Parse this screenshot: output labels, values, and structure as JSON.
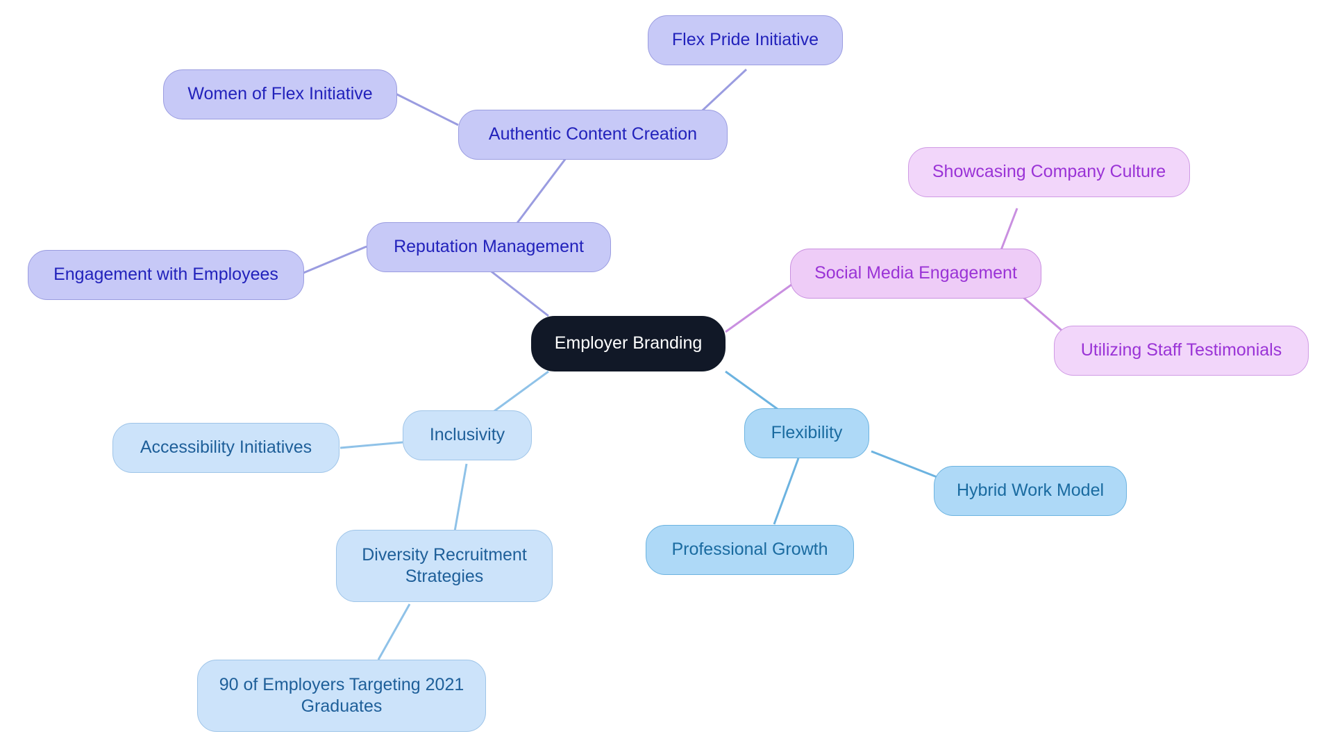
{
  "diagram": {
    "type": "mindmap",
    "title": "Employer Branding",
    "background_color": "#ffffff",
    "palette": {
      "root_fill": "#111827",
      "root_text": "#ffffff",
      "purple_fill": "#c7c9f7",
      "purple_border": "#9a9ce0",
      "purple_text": "#2222bb",
      "pink_fill": "#eeccf7",
      "pink_border": "#c98fe0",
      "pink_text": "#9a33d6",
      "blue_fill": "#aed9f7",
      "blue_border": "#6cb3e0",
      "blue_text": "#1a6ba0",
      "blue_light_fill": "#cce3fa",
      "blue_light_border": "#9ec4e8",
      "blue_light_text": "#1e5f99"
    }
  },
  "nodes": {
    "root": {
      "label": "Employer Branding"
    },
    "reputation_management": {
      "label": "Reputation Management"
    },
    "engagement_with_employees": {
      "label": "Engagement with Employees"
    },
    "authentic_content_creation": {
      "label": "Authentic Content Creation"
    },
    "women_of_flex_initiative": {
      "label": "Women of Flex Initiative"
    },
    "flex_pride_initiative": {
      "label": "Flex Pride Initiative"
    },
    "social_media_engagement": {
      "label": "Social Media Engagement"
    },
    "showcasing_company_culture": {
      "label": "Showcasing Company Culture"
    },
    "utilizing_staff_testimonials": {
      "label": "Utilizing Staff Testimonials"
    },
    "inclusivity": {
      "label": "Inclusivity"
    },
    "accessibility_initiatives": {
      "label": "Accessibility Initiatives"
    },
    "diversity_recruitment_strategies": {
      "label": "Diversity Recruitment\nStrategies"
    },
    "employers_targeting_graduates": {
      "label": "90 of Employers Targeting 2021\nGraduates"
    },
    "flexibility": {
      "label": "Flexibility"
    },
    "professional_growth": {
      "label": "Professional Growth"
    },
    "hybrid_work_model": {
      "label": "Hybrid Work Model"
    }
  },
  "edges": [
    {
      "from": "root",
      "to": "reputation_management",
      "color": "#9a9ce0"
    },
    {
      "from": "reputation_management",
      "to": "engagement_with_employees",
      "color": "#9a9ce0"
    },
    {
      "from": "reputation_management",
      "to": "authentic_content_creation",
      "color": "#9a9ce0"
    },
    {
      "from": "authentic_content_creation",
      "to": "women_of_flex_initiative",
      "color": "#9a9ce0"
    },
    {
      "from": "authentic_content_creation",
      "to": "flex_pride_initiative",
      "color": "#9a9ce0"
    },
    {
      "from": "root",
      "to": "social_media_engagement",
      "color": "#c98fe0"
    },
    {
      "from": "social_media_engagement",
      "to": "showcasing_company_culture",
      "color": "#c98fe0"
    },
    {
      "from": "social_media_engagement",
      "to": "utilizing_staff_testimonials",
      "color": "#c98fe0"
    },
    {
      "from": "root",
      "to": "inclusivity",
      "color": "#8fc2e8"
    },
    {
      "from": "inclusivity",
      "to": "accessibility_initiatives",
      "color": "#8fc2e8"
    },
    {
      "from": "inclusivity",
      "to": "diversity_recruitment_strategies",
      "color": "#8fc2e8"
    },
    {
      "from": "diversity_recruitment_strategies",
      "to": "employers_targeting_graduates",
      "color": "#8fc2e8"
    },
    {
      "from": "root",
      "to": "flexibility",
      "color": "#6cb3e0"
    },
    {
      "from": "flexibility",
      "to": "professional_growth",
      "color": "#6cb3e0"
    },
    {
      "from": "flexibility",
      "to": "hybrid_work_model",
      "color": "#6cb3e0"
    }
  ]
}
